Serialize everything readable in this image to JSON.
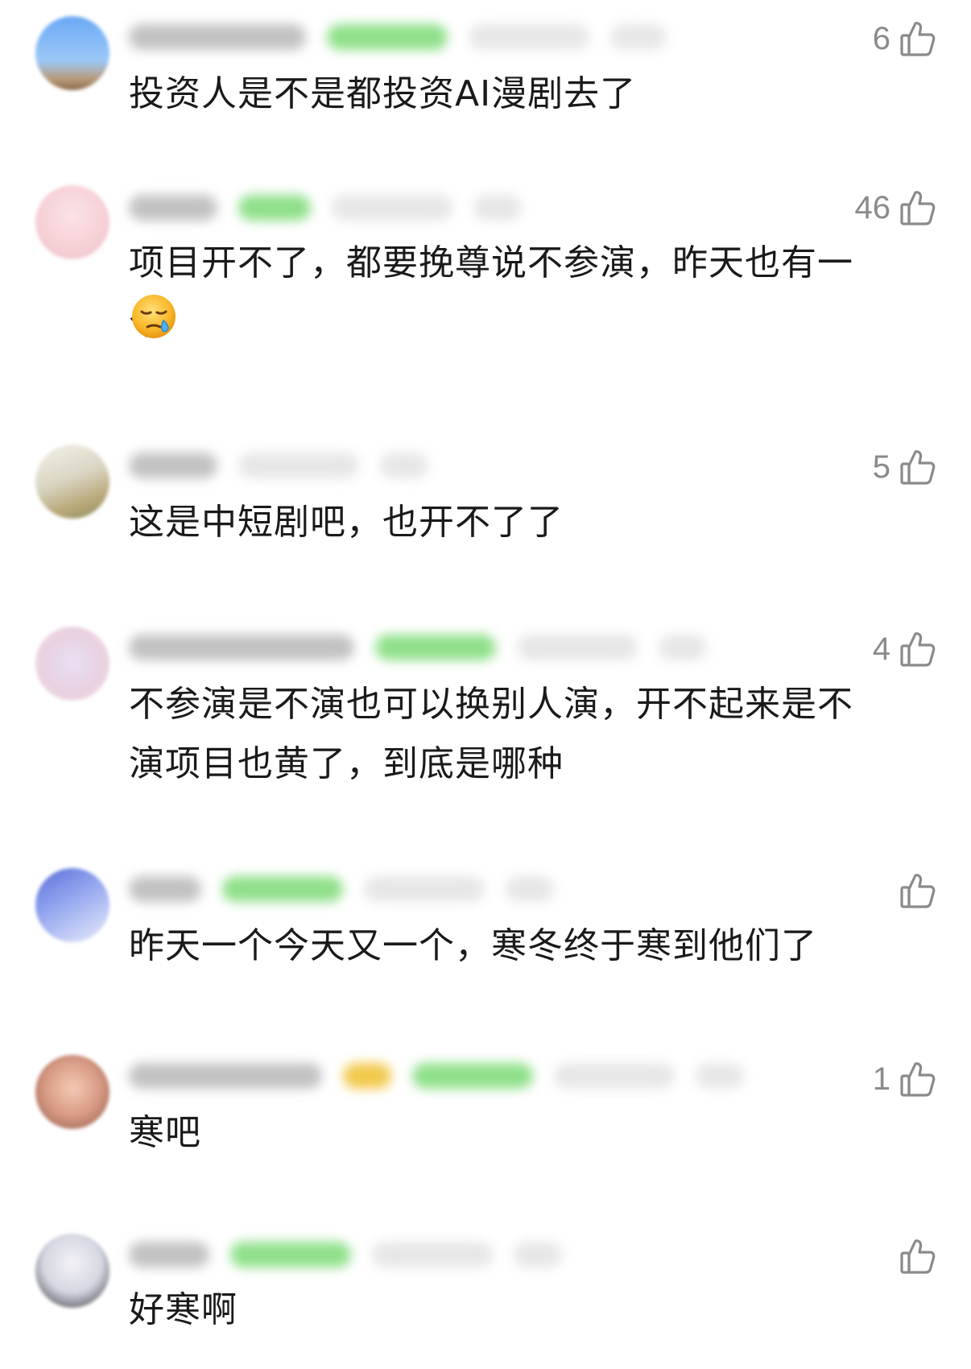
{
  "comments": [
    {
      "text": "投资人是不是都投资AI漫剧去了",
      "likes": "6"
    },
    {
      "text": "项目开不了，都要挽尊说不参演，昨天也有一个",
      "likes": "46",
      "emoji": "sleepy-face"
    },
    {
      "text": "这是中短剧吧，也开不了了",
      "likes": "5"
    },
    {
      "text": "不参演是不演也可以换别人演，开不起来是不演项目也黄了，到底是哪种",
      "likes": "4"
    },
    {
      "text": "昨天一个今天又一个，寒冬终于寒到他们了",
      "likes": ""
    },
    {
      "text": "寒吧",
      "likes": "1"
    },
    {
      "text": "好寒啊",
      "likes": ""
    }
  ],
  "icons": {
    "like": "thumbs-up-outline-icon",
    "emoji": "sleepy-face-emoji"
  },
  "colors": {
    "like_count": "#8a8a8a",
    "badge_green": "#8fe08a"
  }
}
